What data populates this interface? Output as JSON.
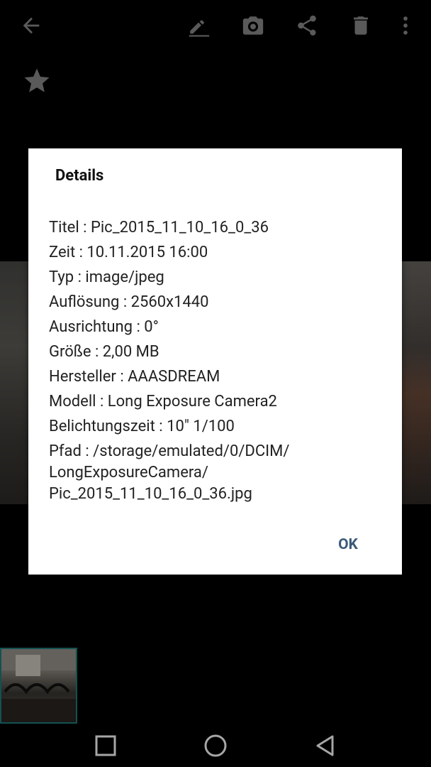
{
  "toolbar": {
    "icons": [
      "back-arrow-icon",
      "edit-icon",
      "camera-icon",
      "share-icon",
      "trash-icon",
      "more-vert-icon"
    ]
  },
  "favorite_icon": "star-icon",
  "dialog": {
    "title": "Details",
    "details": [
      {
        "label": "Titel",
        "value": "Pic_2015_11_10_16_0_36"
      },
      {
        "label": "Zeit",
        "value": "10.11.2015 16:00"
      },
      {
        "label": "Typ",
        "value": "image/jpeg"
      },
      {
        "label": "Auflösung",
        "value": "2560x1440"
      },
      {
        "label": "Ausrichtung",
        "value": "0°"
      },
      {
        "label": "Größe",
        "value": "2,00 MB"
      },
      {
        "label": "Hersteller",
        "value": "AAASDREAM"
      },
      {
        "label": "Modell",
        "value": "Long Exposure Camera2"
      },
      {
        "label": "Belichtungszeit",
        "value": "10\" 1/100"
      },
      {
        "label": "Pfad",
        "value": "/storage/emulated/0/DCIM/\nLongExposureCamera/\nPic_2015_11_10_16_0_36.jpg"
      }
    ],
    "ok_label": "OK"
  },
  "navbar": {
    "icons": [
      "recents-square-icon",
      "home-circle-icon",
      "back-triangle-icon"
    ]
  },
  "colors": {
    "background": "#000000",
    "dialog_bg": "#ffffff",
    "accent": "#3a5a78",
    "thumb_border": "#1e7d7d"
  }
}
